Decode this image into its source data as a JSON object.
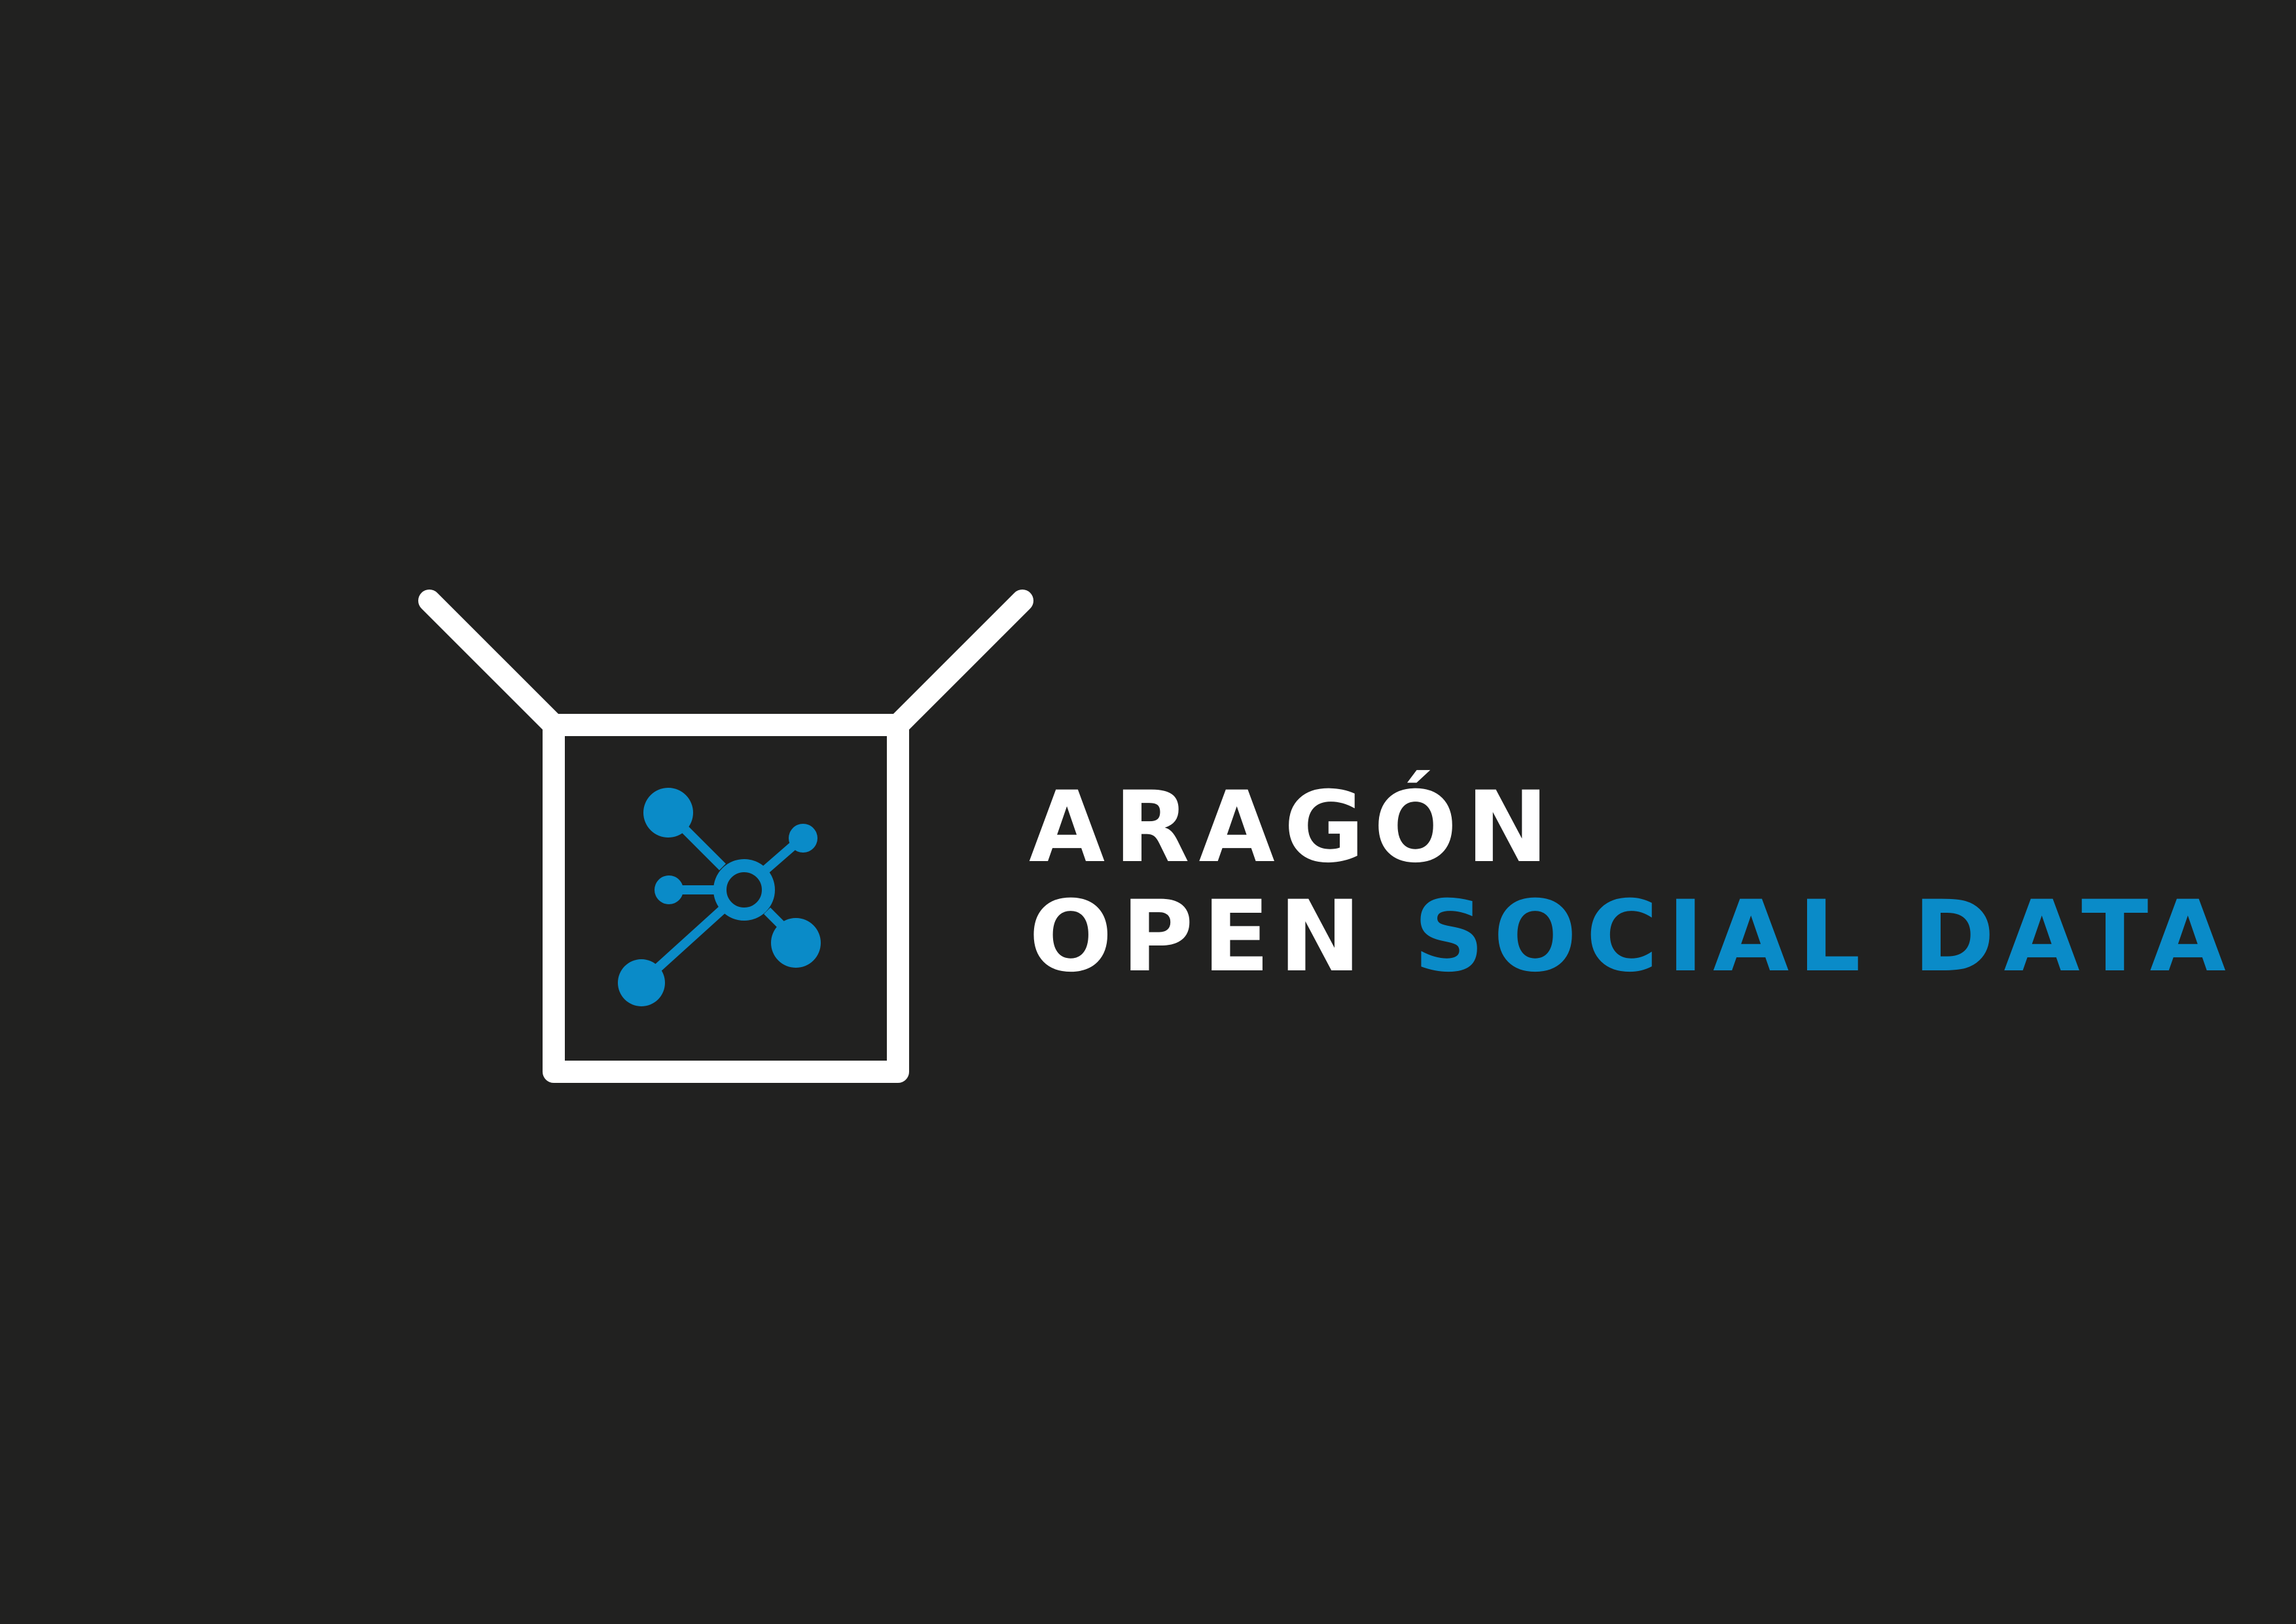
{
  "logo": {
    "line1": "ARAGÓN",
    "line2_part1": "OPEN",
    "line2_part2": "SOCIAL DATA",
    "icon": "box-with-network-nodes-icon"
  },
  "colors": {
    "background": "#212120",
    "white": "#ffffff",
    "brand_blue": "#0a8bc8"
  }
}
